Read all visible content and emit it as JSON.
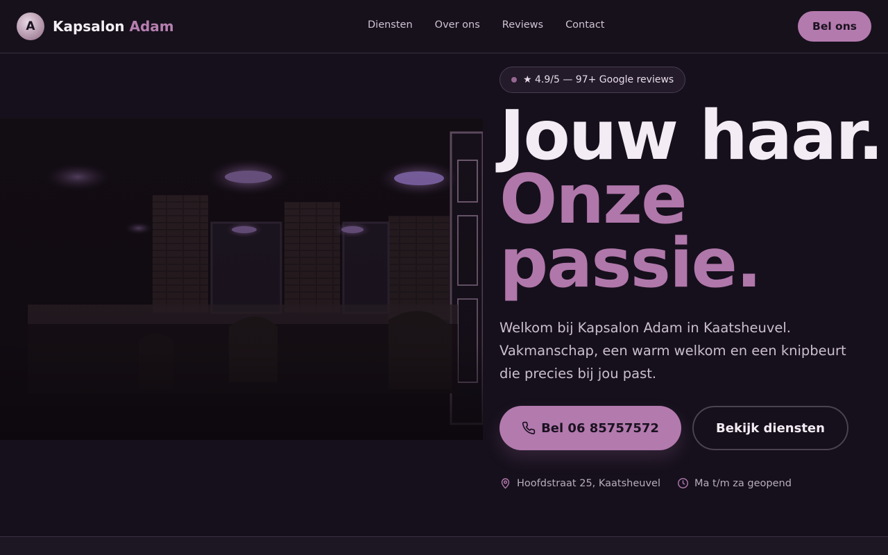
{
  "header": {
    "logo_letter": "A",
    "brand_main": "Kapsalon",
    "brand_accent": "Adam",
    "nav": [
      "Diensten",
      "Over ons",
      "Reviews",
      "Contact"
    ],
    "call_button": "Bel ons"
  },
  "hero": {
    "badge": "★ 4.9/5 — 97+ Google reviews",
    "headline_line1": "Jouw haar.",
    "headline_line2": "Onze",
    "headline_line3": "passie.",
    "lead": "Welkom bij Kapsalon Adam in Kaatsheuvel. Vakmanschap, een warm welkom en een knipbeurt die precies bij jou past.",
    "primary_button": "Bel 06 85757572",
    "secondary_button": "Bekijk diensten",
    "address": "Hoofdstraat 25, Kaatsheuvel",
    "hours": "Ma t/m za geopend"
  },
  "icons": {
    "phone": "phone-icon",
    "location": "map-pin-icon",
    "clock": "clock-icon"
  },
  "colors": {
    "accent": "#b37aae",
    "background": "#16101c",
    "text": "#f3ecf4"
  }
}
